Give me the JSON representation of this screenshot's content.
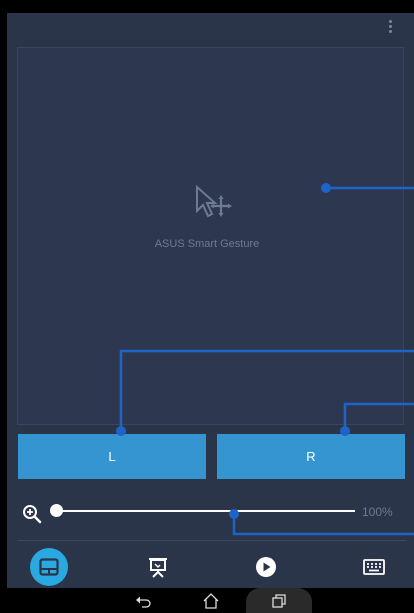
{
  "app": {
    "touchpad_label": "ASUS Smart Gesture",
    "left_button_label": "L",
    "right_button_label": "R",
    "zoom_value": "100%",
    "zoom_level_fraction": 0.0
  },
  "icons": {
    "overflow": "more-vert-icon",
    "gesture": "cursor-move-icon",
    "zoom": "zoom-in-icon",
    "tabs": [
      "touchpad-icon",
      "presentation-icon",
      "play-icon",
      "keyboard-icon"
    ],
    "nav": [
      "back-icon",
      "home-icon",
      "recent-apps-icon"
    ]
  },
  "colors": {
    "background": "#2b3549",
    "button": "#3595d0",
    "active_tab": "#2aa8e0",
    "callout": "#1e64c8"
  }
}
